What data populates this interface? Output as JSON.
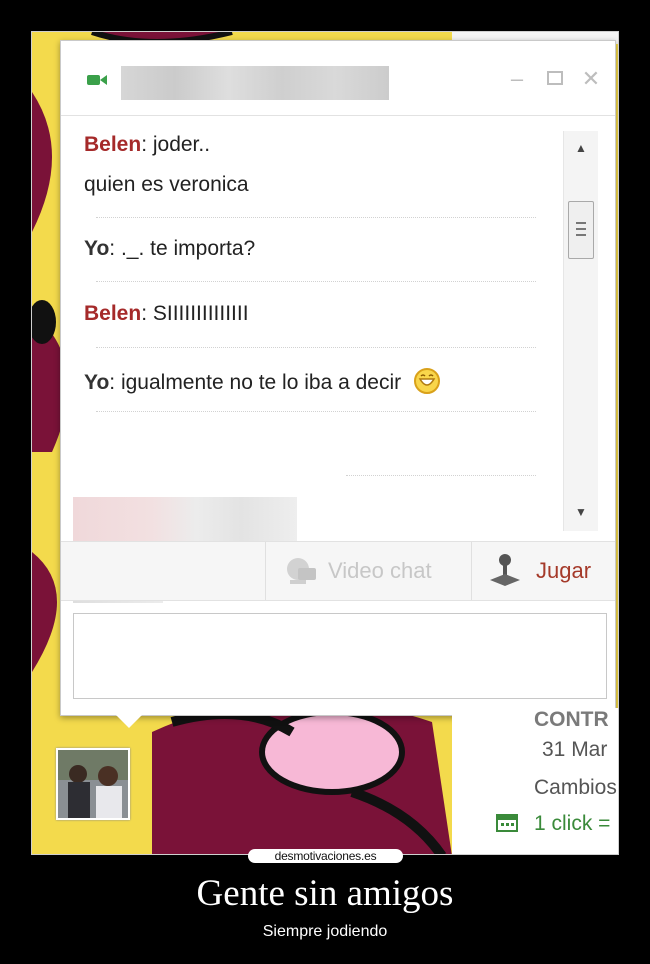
{
  "chat": {
    "messages": [
      {
        "sender": "Belen",
        "text": ": joder.."
      },
      {
        "text": "quien es veronica"
      },
      {
        "sender": "Yo",
        "text": ": ._. te importa?"
      },
      {
        "sender": "Belen",
        "text": ": SIIIIIIIIIIIIII"
      },
      {
        "sender": "Yo",
        "text": ": igualmente no te lo iba a decir"
      }
    ],
    "actions": {
      "video_chat_label": "Video chat",
      "jugar_label": "Jugar"
    },
    "icons": [
      "video-camera-icon",
      "minimize-icon",
      "maximize-icon",
      "close-icon",
      "smiley-icon",
      "webcam-icon",
      "game-piece-icon"
    ]
  },
  "side_panel": {
    "line1": "CONTR",
    "line2": "31 Mar",
    "line3": "Cambios",
    "line4": "1 click ="
  },
  "watermark": "desmotivaciones.es",
  "caption": {
    "title": "Gente sin amigos",
    "subtitle": "Siempre jodiendo"
  },
  "colors": {
    "sender_other": "#a52a2a",
    "sender_self": "#333333",
    "jugar": "#a53a2a",
    "video_chat_disabled": "#c7c7c7",
    "link_green": "#3a8a3a"
  }
}
